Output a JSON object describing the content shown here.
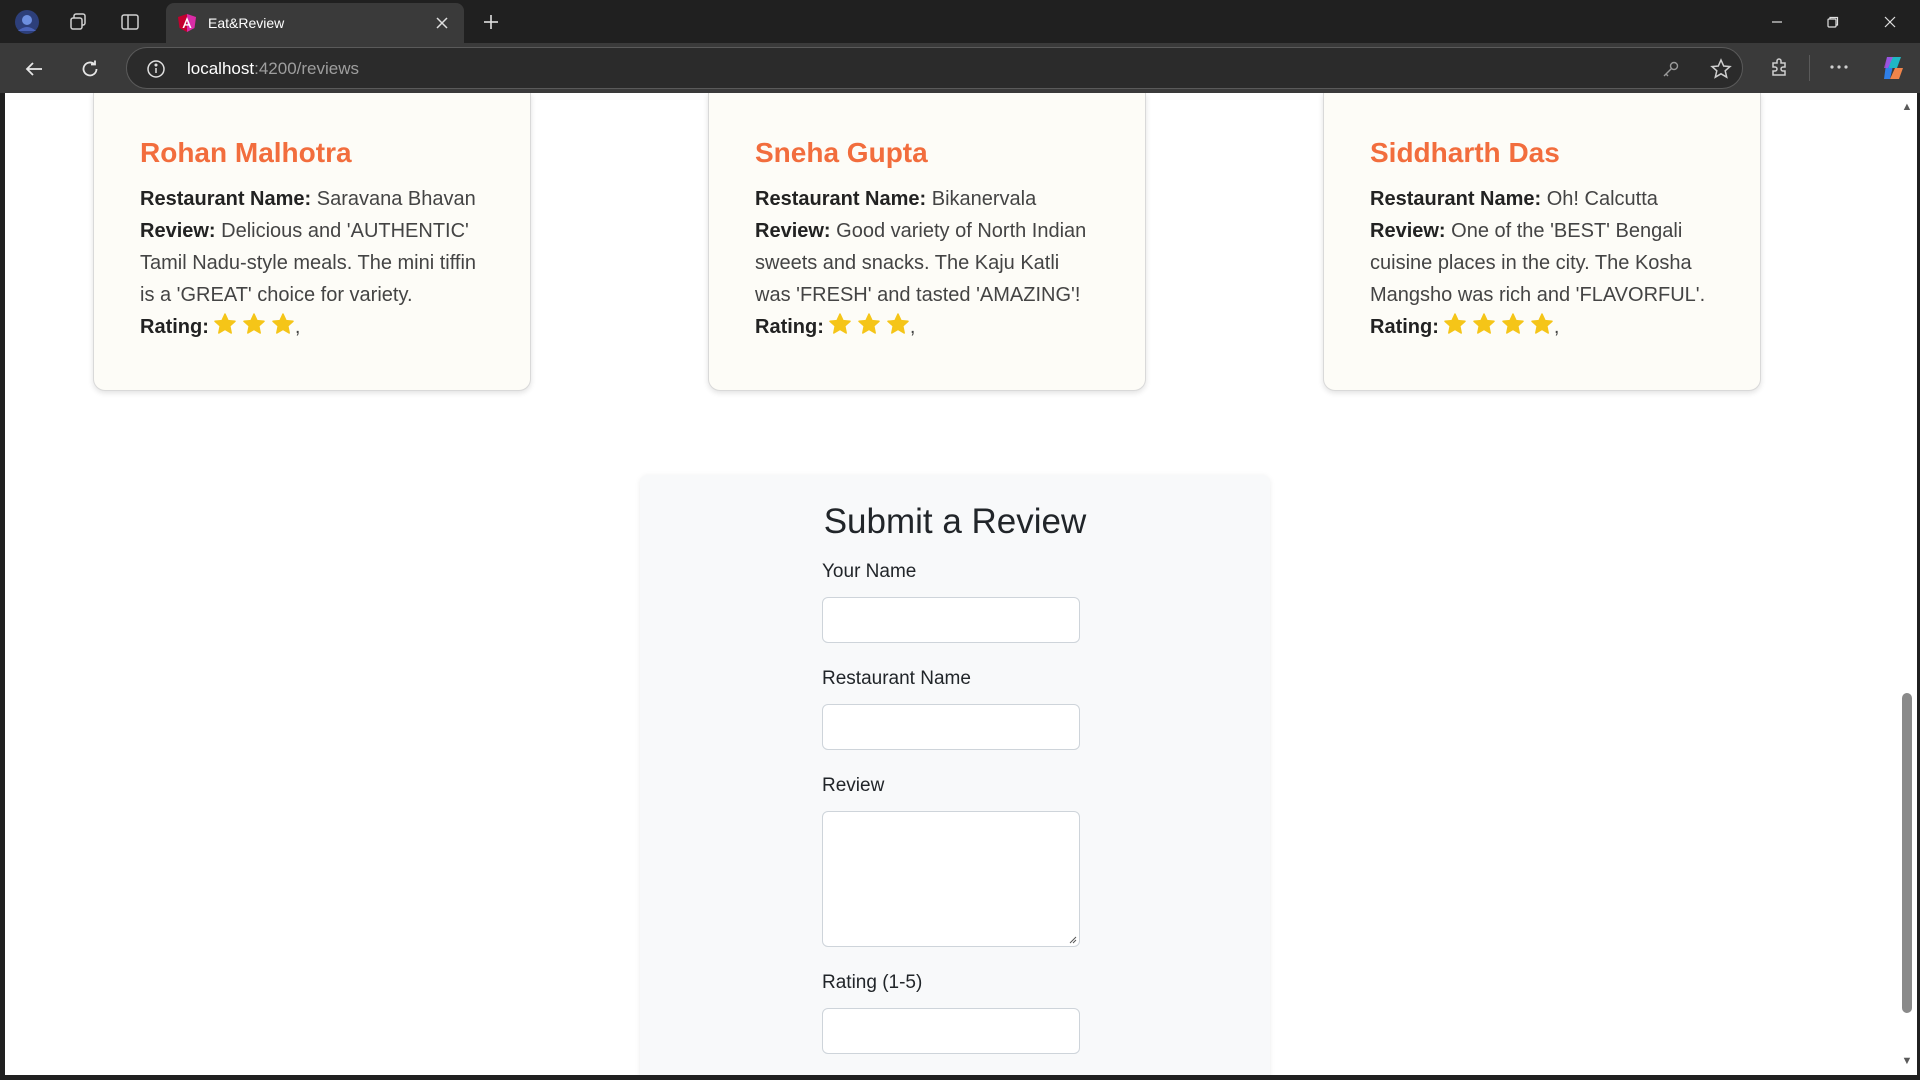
{
  "browser": {
    "tab_title": "Eat&Review",
    "url_host": "localhost",
    "url_rest": ":4200/reviews"
  },
  "reviews": [
    {
      "name": "Rohan Malhotra",
      "restaurant_label": "Restaurant Name:",
      "restaurant": "Saravana Bhavan",
      "review_label": "Review:",
      "review": "Delicious and 'AUTHENTIC' Tamil Nadu-style meals. The mini tiffin is a 'GREAT' choice for variety.",
      "rating_label": "Rating:",
      "rating": 3,
      "rating_suffix": ","
    },
    {
      "name": "Sneha Gupta",
      "restaurant_label": "Restaurant Name:",
      "restaurant": "Bikanervala",
      "review_label": "Review:",
      "review": "Good variety of North Indian sweets and snacks. The Kaju Katli was 'FRESH' and tasted 'AMAZING'!",
      "rating_label": "Rating:",
      "rating": 3,
      "rating_suffix": ","
    },
    {
      "name": "Siddharth Das",
      "restaurant_label": "Restaurant Name:",
      "restaurant": "Oh! Calcutta",
      "review_label": "Review:",
      "review": "One of the 'BEST' Bengali cuisine places in the city. The Kosha Mangsho was rich and 'FLAVORFUL'.",
      "rating_label": "Rating:",
      "rating": 4,
      "rating_suffix": ","
    }
  ],
  "form": {
    "title": "Submit a Review",
    "name_label": "Your Name",
    "name_value": "",
    "restaurant_label": "Restaurant Name",
    "restaurant_value": "",
    "review_label": "Review",
    "review_value": "",
    "rating_label": "Rating (1-5)",
    "rating_value": ""
  },
  "colors": {
    "accent": "#f26d3d",
    "star": "#f5c518"
  }
}
